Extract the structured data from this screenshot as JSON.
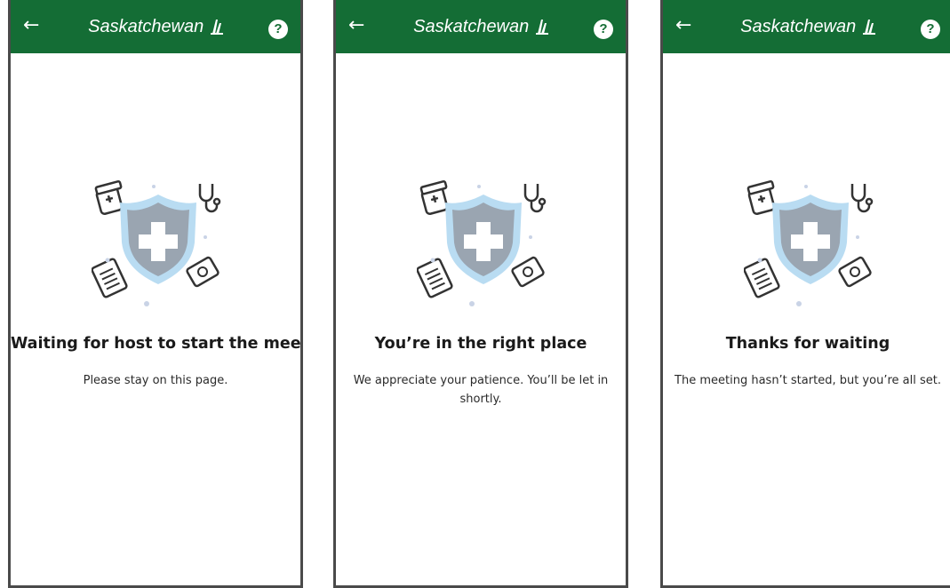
{
  "brand": {
    "name": "Saskatchewan"
  },
  "icons": {
    "back": "back-arrow-icon",
    "help": "help-question-icon",
    "logo": "wheat-logo-icon"
  },
  "colors": {
    "header": "#146d35",
    "shield": "#b9dcf2",
    "shield_inner": "#9aa5b1"
  },
  "screens": [
    {
      "title": "Waiting for host to start the meeting",
      "message": "Please stay on this page.",
      "help": "?",
      "back": "←"
    },
    {
      "title": "You’re in the right place",
      "message": "We appreciate your patience. You’ll be let in shortly.",
      "help": "?",
      "back": "←"
    },
    {
      "title": "Thanks for waiting",
      "message": "The meeting hasn’t started, but you’re all set.",
      "help": "?",
      "back": "←"
    }
  ]
}
